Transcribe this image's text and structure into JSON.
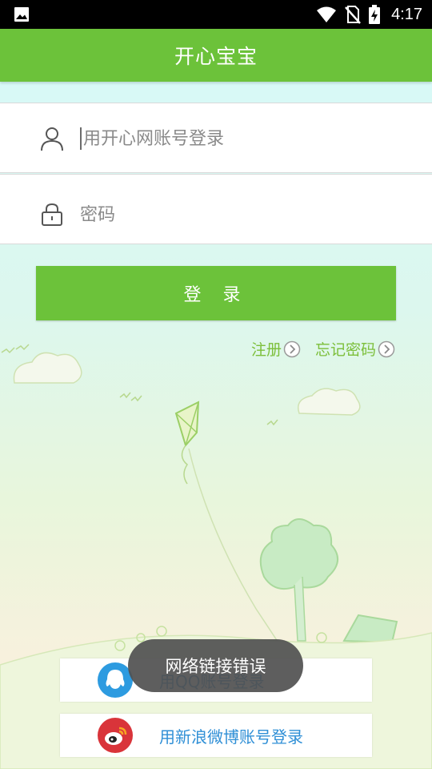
{
  "status_bar": {
    "time": "4:17",
    "left_icon": "image-notification-icon",
    "icons": [
      "wifi-icon",
      "no-sim-icon",
      "battery-charging-icon"
    ]
  },
  "app_bar": {
    "title": "开心宝宝"
  },
  "login_form": {
    "account_placeholder": "用开心网账号登录",
    "password_placeholder": "密码",
    "login_button": "登 录"
  },
  "links": {
    "register": "注册",
    "forgot_password": "忘记密码"
  },
  "social_login": {
    "qq_label": "用QQ账号登录",
    "weibo_label": "用新浪微博账号登录"
  },
  "toast": {
    "message": "网络链接错误"
  },
  "colors": {
    "accent": "#6cc23a",
    "link_green": "#7cbf3a",
    "social_blue": "#2f8fd6"
  }
}
